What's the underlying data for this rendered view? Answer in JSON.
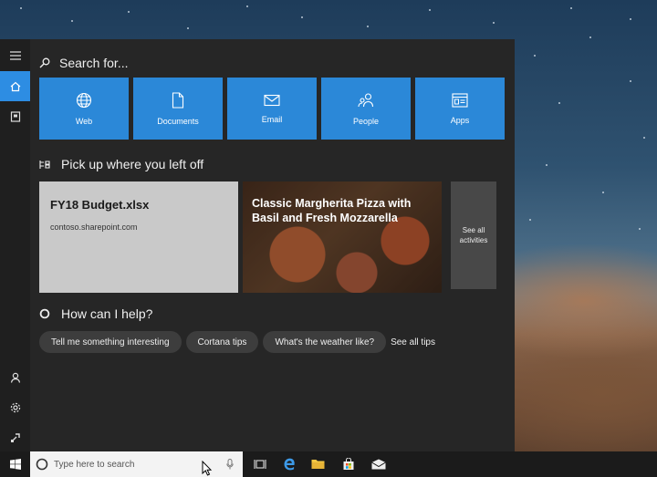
{
  "search": {
    "label": "Search for..."
  },
  "tiles": [
    {
      "label": "Web",
      "icon": "globe-icon"
    },
    {
      "label": "Documents",
      "icon": "document-icon"
    },
    {
      "label": "Email",
      "icon": "mail-icon"
    },
    {
      "label": "People",
      "icon": "people-icon"
    },
    {
      "label": "Apps",
      "icon": "apps-icon"
    }
  ],
  "recent": {
    "title": "Pick up where you left off",
    "doc": {
      "title": "FY18 Budget.xlsx",
      "source": "contoso.sharepoint.com"
    },
    "article": {
      "title": "Classic Margherita Pizza with Basil and Fresh Mozzarella"
    },
    "see_all": "See all activities"
  },
  "help": {
    "title": "How can I help?",
    "chips": [
      "Tell me something interesting",
      "Cortana tips",
      "What's the weather like?"
    ],
    "see_all": "See all tips"
  },
  "taskbar": {
    "search_placeholder": "Type here to search"
  },
  "colors": {
    "accent": "#2b88d8",
    "panel": "#262626",
    "rail": "#1f1f1f",
    "chip": "#3d3d3d"
  }
}
